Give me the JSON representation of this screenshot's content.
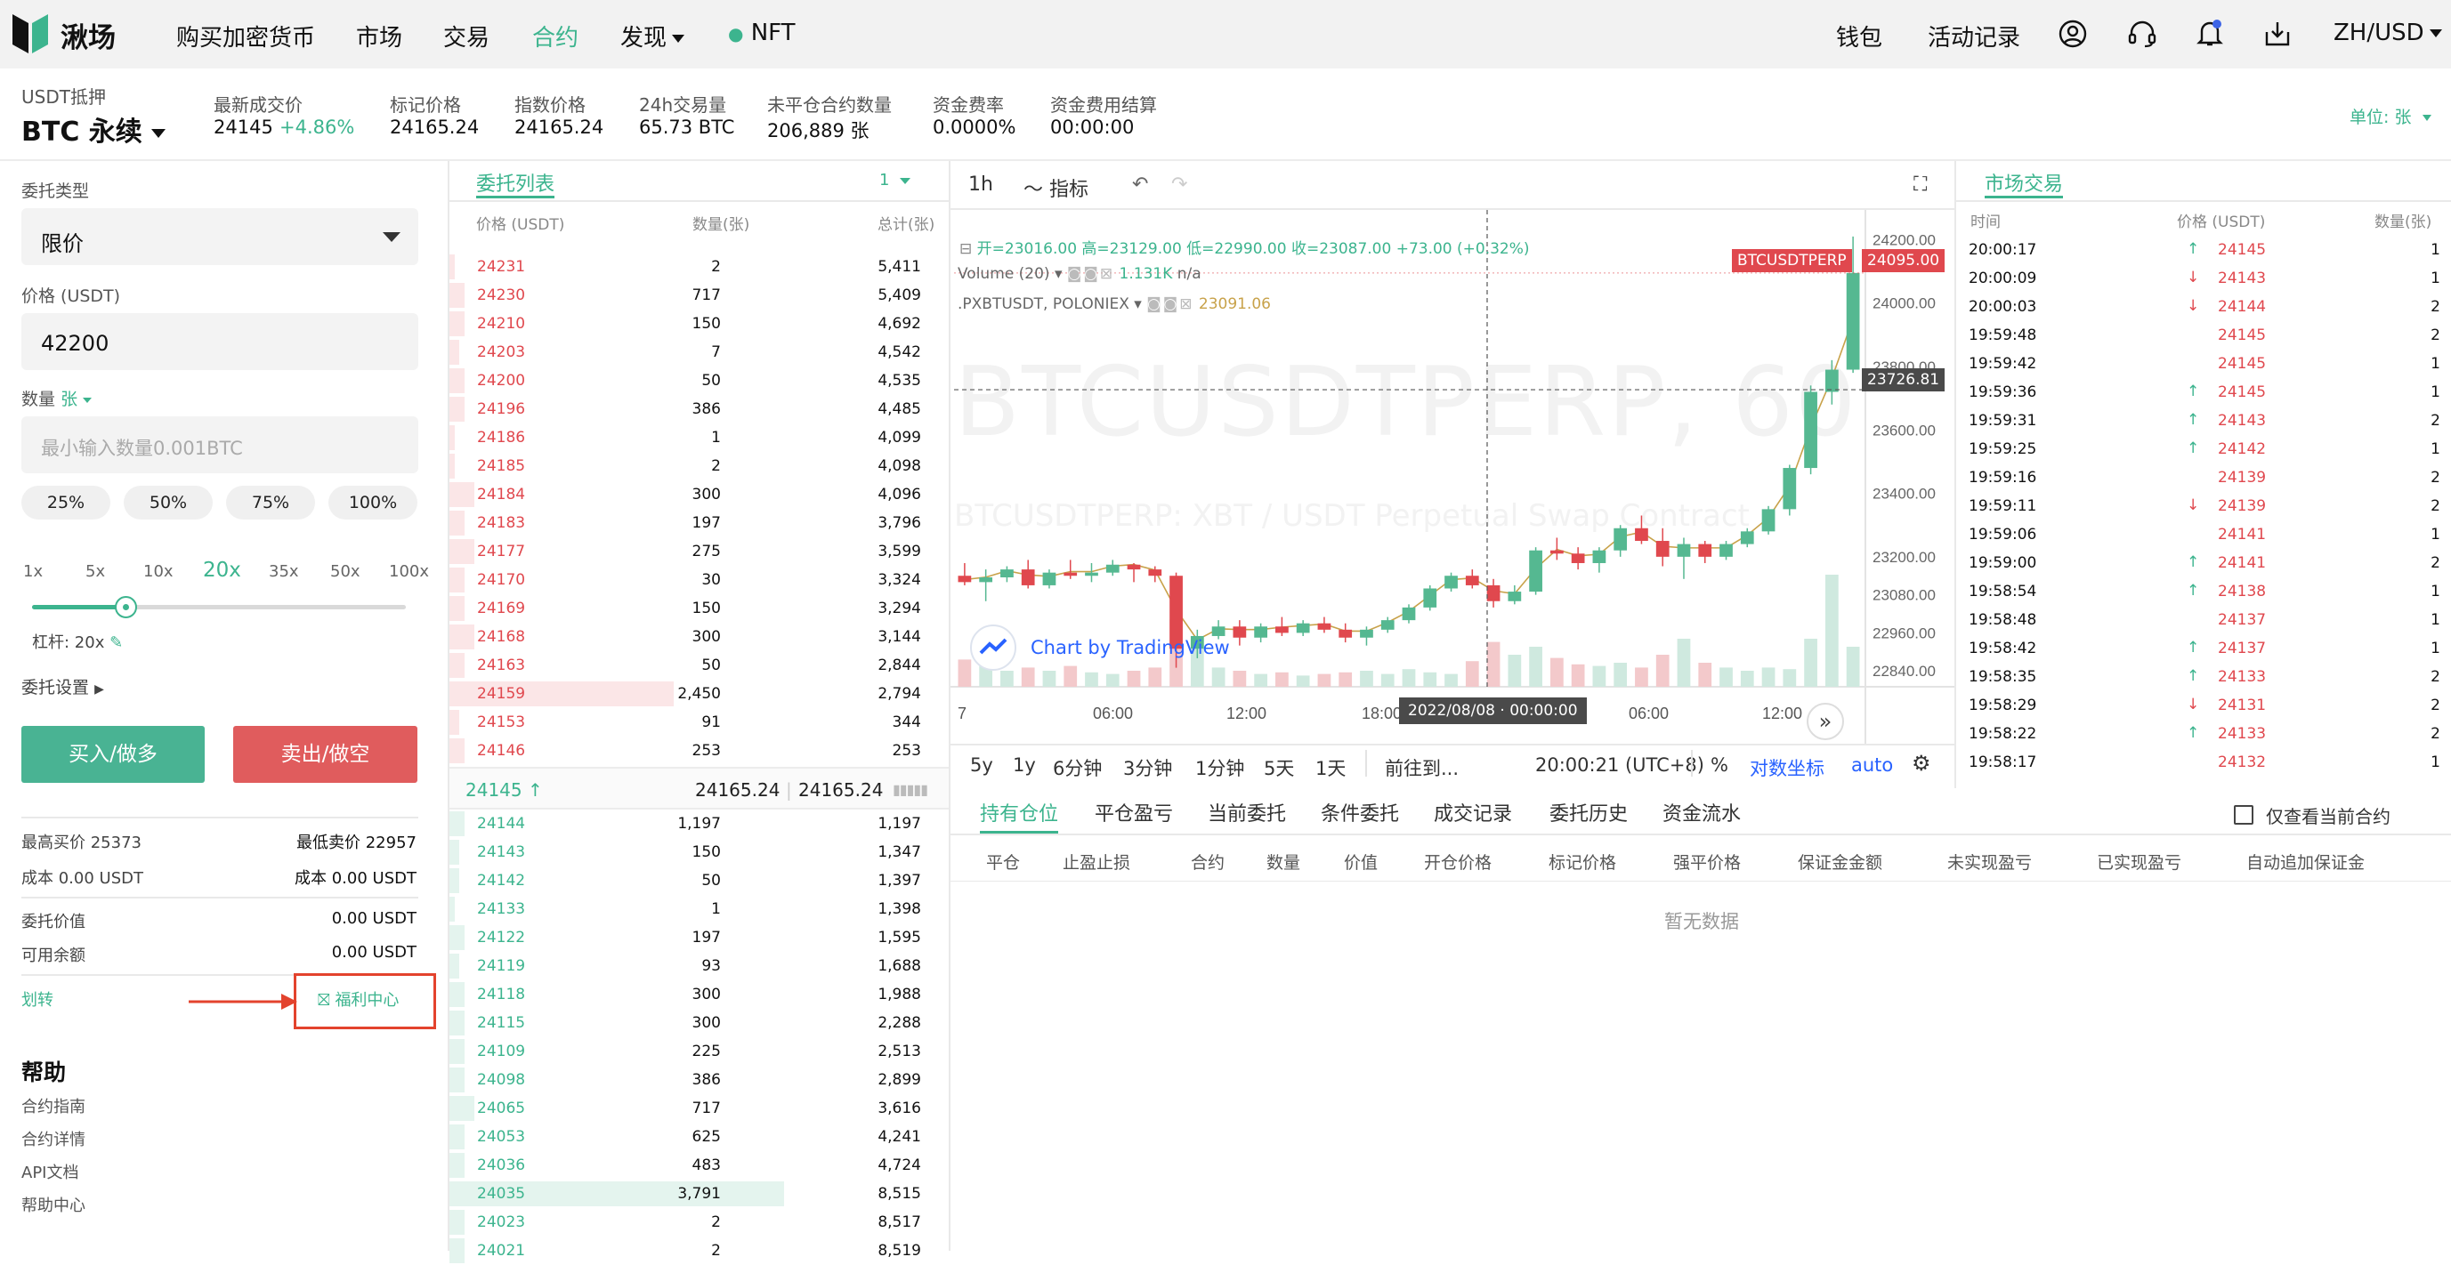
{
  "header": {
    "brand": "湫场",
    "nav": [
      {
        "label": "购买加密货币"
      },
      {
        "label": "市场"
      },
      {
        "label": "交易"
      },
      {
        "label": "合约"
      },
      {
        "label": "发现"
      },
      {
        "label": "NFT"
      }
    ],
    "right": {
      "wallet": "钱包",
      "activity": "活动记录",
      "locale": "ZH/USD"
    }
  },
  "ticker": {
    "collateral": "USDT抵押",
    "symbol": "BTC 永续",
    "stats": [
      {
        "label": "最新成交价",
        "value": "24145",
        "change": "+4.86%"
      },
      {
        "label": "标记价格",
        "value": "24165.24"
      },
      {
        "label": "指数价格",
        "value": "24165.24"
      },
      {
        "label": "24h交易量",
        "value": "65.73 BTC"
      },
      {
        "label": "未平仓合约数量",
        "value": "206,889 张"
      },
      {
        "label": "资金费率",
        "value": "0.0000%"
      },
      {
        "label": "资金费用结算",
        "value": "00:00:00"
      }
    ],
    "unit": "单位: 张"
  },
  "order_form": {
    "type_label": "委托类型",
    "type_value": "限价",
    "price_label": "价格 (USDT)",
    "price_value": "42200",
    "qty_label": "数量",
    "qty_unit": "张",
    "qty_placeholder": "最小输入数量0.001BTC",
    "pct": [
      "25%",
      "50%",
      "75%",
      "100%"
    ],
    "leverages": [
      "1x",
      "5x",
      "10x",
      "20x",
      "35x",
      "50x",
      "100x"
    ],
    "leverage_value": 0.25,
    "leverage_text": "杠杆: 20x",
    "settings": "委托设置",
    "buy": "买入/做多",
    "sell": "卖出/做空",
    "best_bid_label": "最高买价",
    "best_bid": "25373",
    "best_ask_label": "最低卖价",
    "best_ask": "22957",
    "cost_buy": "成本 0.00 USDT",
    "cost_sell_label": "成本",
    "cost_sell": "0.00 USDT",
    "order_value_label": "委托价值",
    "order_value": "0.00 USDT",
    "available_label": "可用余额",
    "available": "0.00 USDT",
    "transfer": "划转",
    "welfare": "福利中心",
    "help_title": "帮助",
    "help_links": [
      "合约指南",
      "合约详情",
      "API文档",
      "帮助中心"
    ]
  },
  "orderbook": {
    "title": "委托列表",
    "precision": "1",
    "headers": [
      "价格 (USDT)",
      "数量(张)",
      "总计(张)"
    ],
    "asks": [
      {
        "price": "24231",
        "qty": "2",
        "total": "5,411",
        "depth": 0.0
      },
      {
        "price": "24230",
        "qty": "717",
        "total": "5,409",
        "depth": 0.03
      },
      {
        "price": "24210",
        "qty": "150",
        "total": "4,692",
        "depth": 0.03
      },
      {
        "price": "24203",
        "qty": "7",
        "total": "4,542",
        "depth": 0.02
      },
      {
        "price": "24200",
        "qty": "50",
        "total": "4,535",
        "depth": 0.03
      },
      {
        "price": "24196",
        "qty": "386",
        "total": "4,485",
        "depth": 0.03
      },
      {
        "price": "24186",
        "qty": "1",
        "total": "4,099",
        "depth": 0.0
      },
      {
        "price": "24185",
        "qty": "2",
        "total": "4,098",
        "depth": 0.0
      },
      {
        "price": "24184",
        "qty": "300",
        "total": "4,096",
        "depth": 0.05
      },
      {
        "price": "24183",
        "qty": "197",
        "total": "3,796",
        "depth": 0.03
      },
      {
        "price": "24177",
        "qty": "275",
        "total": "3,599",
        "depth": 0.05
      },
      {
        "price": "24170",
        "qty": "30",
        "total": "3,324",
        "depth": 0.03
      },
      {
        "price": "24169",
        "qty": "150",
        "total": "3,294",
        "depth": 0.03
      },
      {
        "price": "24168",
        "qty": "300",
        "total": "3,144",
        "depth": 0.05
      },
      {
        "price": "24163",
        "qty": "50",
        "total": "2,844",
        "depth": 0.03
      },
      {
        "price": "24159",
        "qty": "2,450",
        "total": "2,794",
        "depth": 0.45
      },
      {
        "price": "24153",
        "qty": "91",
        "total": "344",
        "depth": 0.02
      },
      {
        "price": "24146",
        "qty": "253",
        "total": "253",
        "depth": 0.03
      }
    ],
    "last_price": "24145",
    "mark_price": "24165.24",
    "index_price": "24165.24",
    "bids": [
      {
        "price": "24144",
        "qty": "1,197",
        "total": "1,197",
        "depth": 0.03
      },
      {
        "price": "24143",
        "qty": "150",
        "total": "1,347",
        "depth": 0.02
      },
      {
        "price": "24142",
        "qty": "50",
        "total": "1,397",
        "depth": 0.02
      },
      {
        "price": "24133",
        "qty": "1",
        "total": "1,398",
        "depth": 0.0
      },
      {
        "price": "24122",
        "qty": "197",
        "total": "1,595",
        "depth": 0.03
      },
      {
        "price": "24119",
        "qty": "93",
        "total": "1,688",
        "depth": 0.02
      },
      {
        "price": "24118",
        "qty": "300",
        "total": "1,988",
        "depth": 0.03
      },
      {
        "price": "24115",
        "qty": "300",
        "total": "2,288",
        "depth": 0.03
      },
      {
        "price": "24109",
        "qty": "225",
        "total": "2,513",
        "depth": 0.03
      },
      {
        "price": "24098",
        "qty": "386",
        "total": "2,899",
        "depth": 0.03
      },
      {
        "price": "24065",
        "qty": "717",
        "total": "3,616",
        "depth": 0.05
      },
      {
        "price": "24053",
        "qty": "625",
        "total": "4,241",
        "depth": 0.03
      },
      {
        "price": "24036",
        "qty": "483",
        "total": "4,724",
        "depth": 0.03
      },
      {
        "price": "24035",
        "qty": "3,791",
        "total": "8,515",
        "depth": 0.67
      },
      {
        "price": "24023",
        "qty": "2",
        "total": "8,517",
        "depth": 0.03
      },
      {
        "price": "24021",
        "qty": "2",
        "total": "8,519",
        "depth": 0.03
      }
    ]
  },
  "chart": {
    "interval": "1h",
    "indicators": "指标",
    "ohlc_line": "开=23016.00 高=23129.00 低=22990.00 收=23087.00 +73.00 (+0.32%)",
    "volume_label": "Volume (20)",
    "volume_value": "1.131K",
    "volume_na": "n/a",
    "compare_label": ".PXBTUSDT, POLONIEX",
    "compare_value": "23091.06",
    "watermark_big": "BTCUSDTPERP, 60",
    "watermark_small": "BTCUSDTPERP: XBT / USDT Perpetual Swap Contract",
    "attribution": "Chart by TradingView",
    "symbol_tag": "BTCUSDTPERP",
    "last_tag": "24095.00",
    "cross_tag": "23726.81",
    "time_tag": "2022/08/08 · 00:00:00",
    "y_ticks": [
      "24200.00",
      "24000.00",
      "23800.00",
      "23600.00",
      "23400.00",
      "23200.00",
      "23080.00",
      "22960.00",
      "22840.00"
    ],
    "x_ticks": [
      "7",
      "06:00",
      "12:00",
      "18:00",
      "06:00",
      "12:00"
    ],
    "ranges": [
      "5y",
      "1y",
      "6分钟",
      "3分钟",
      "1分钟",
      "5天",
      "1天",
      "前往到..."
    ],
    "clock": "20:00:21 (UTC+8)",
    "pct": "%",
    "log": "对数坐标",
    "auto": "auto"
  },
  "chart_data": {
    "type": "candlestick",
    "y_range": [
      22790,
      24260
    ],
    "candles": [
      [
        23140,
        23180,
        23110,
        23120
      ],
      [
        23120,
        23160,
        23060,
        23135
      ],
      [
        23135,
        23170,
        23120,
        23160
      ],
      [
        23160,
        23190,
        23100,
        23110
      ],
      [
        23110,
        23160,
        23100,
        23150
      ],
      [
        23150,
        23190,
        23130,
        23140
      ],
      [
        23140,
        23180,
        23120,
        23150
      ],
      [
        23150,
        23190,
        23140,
        23175
      ],
      [
        23175,
        23180,
        23120,
        23160
      ],
      [
        23160,
        23170,
        23120,
        23140
      ],
      [
        23140,
        23150,
        22850,
        22910
      ],
      [
        22910,
        22970,
        22880,
        22950
      ],
      [
        22950,
        23000,
        22940,
        22980
      ],
      [
        22980,
        23000,
        22920,
        22945
      ],
      [
        22945,
        22990,
        22930,
        22980
      ],
      [
        22980,
        23010,
        22950,
        22960
      ],
      [
        22960,
        23000,
        22950,
        22990
      ],
      [
        22990,
        23010,
        22960,
        22970
      ],
      [
        22970,
        22990,
        22930,
        22945
      ],
      [
        22945,
        22980,
        22920,
        22970
      ],
      [
        22970,
        23010,
        22960,
        23000
      ],
      [
        23000,
        23050,
        22990,
        23040
      ],
      [
        23040,
        23110,
        23030,
        23100
      ],
      [
        23100,
        23150,
        23090,
        23140
      ],
      [
        23140,
        23160,
        23100,
        23110
      ],
      [
        23110,
        23130,
        23040,
        23060
      ],
      [
        23060,
        23110,
        23050,
        23090
      ],
      [
        23090,
        23230,
        23080,
        23220
      ],
      [
        23220,
        23260,
        23190,
        23210
      ],
      [
        23210,
        23230,
        23160,
        23180
      ],
      [
        23180,
        23230,
        23150,
        23220
      ],
      [
        23220,
        23300,
        23200,
        23290
      ],
      [
        23290,
        23330,
        23240,
        23250
      ],
      [
        23250,
        23290,
        23170,
        23200
      ],
      [
        23200,
        23260,
        23130,
        23240
      ],
      [
        23240,
        23250,
        23180,
        23200
      ],
      [
        23200,
        23250,
        23190,
        23240
      ],
      [
        23240,
        23290,
        23230,
        23280
      ],
      [
        23280,
        23360,
        23270,
        23350
      ],
      [
        23350,
        23490,
        23330,
        23480
      ],
      [
        23480,
        23740,
        23460,
        23720
      ],
      [
        23720,
        23820,
        23680,
        23790
      ],
      [
        23790,
        24210,
        23780,
        24095
      ]
    ],
    "volumes": [
      0.17,
      0.15,
      0.1,
      0.12,
      0.1,
      0.13,
      0.09,
      0.08,
      0.1,
      0.12,
      0.42,
      0.3,
      0.12,
      0.1,
      0.08,
      0.09,
      0.07,
      0.08,
      0.09,
      0.1,
      0.08,
      0.11,
      0.09,
      0.08,
      0.16,
      0.28,
      0.2,
      0.25,
      0.18,
      0.14,
      0.13,
      0.15,
      0.12,
      0.2,
      0.3,
      0.15,
      0.12,
      0.1,
      0.12,
      0.11,
      0.3,
      0.7,
      0.25
    ]
  },
  "bottom": {
    "tabs": [
      "持有仓位",
      "平仓盈亏",
      "当前委托",
      "条件委托",
      "成交记录",
      "委托历史",
      "资金流水"
    ],
    "only_current": "仅查看当前合约",
    "columns": [
      "平仓",
      "止盈止损",
      "合约",
      "数量",
      "价值",
      "开仓价格",
      "标记价格",
      "强平价格",
      "保证金金额",
      "未实现盈亏",
      "已实现盈亏",
      "自动追加保证金"
    ],
    "empty": "暂无数据"
  },
  "trades": {
    "title": "市场交易",
    "headers": [
      "时间",
      "价格 (USDT)",
      "数量(张)"
    ],
    "rows": [
      {
        "time": "20:00:17",
        "dir": "up",
        "price": "24145",
        "amount": "1"
      },
      {
        "time": "20:00:09",
        "dir": "down",
        "price": "24143",
        "amount": "1"
      },
      {
        "time": "20:00:03",
        "dir": "down",
        "price": "24144",
        "amount": "2"
      },
      {
        "time": "19:59:48",
        "dir": "",
        "price": "24145",
        "amount": "2"
      },
      {
        "time": "19:59:42",
        "dir": "",
        "price": "24145",
        "amount": "1"
      },
      {
        "time": "19:59:36",
        "dir": "up",
        "price": "24145",
        "amount": "1"
      },
      {
        "time": "19:59:31",
        "dir": "up",
        "price": "24143",
        "amount": "2"
      },
      {
        "time": "19:59:25",
        "dir": "up",
        "price": "24142",
        "amount": "1"
      },
      {
        "time": "19:59:16",
        "dir": "",
        "price": "24139",
        "amount": "2"
      },
      {
        "time": "19:59:11",
        "dir": "down",
        "price": "24139",
        "amount": "2"
      },
      {
        "time": "19:59:06",
        "dir": "",
        "price": "24141",
        "amount": "1"
      },
      {
        "time": "19:59:00",
        "dir": "up",
        "price": "24141",
        "amount": "2"
      },
      {
        "time": "19:58:54",
        "dir": "up",
        "price": "24138",
        "amount": "1"
      },
      {
        "time": "19:58:48",
        "dir": "",
        "price": "24137",
        "amount": "1"
      },
      {
        "time": "19:58:42",
        "dir": "up",
        "price": "24137",
        "amount": "1"
      },
      {
        "time": "19:58:35",
        "dir": "up",
        "price": "24133",
        "amount": "2"
      },
      {
        "time": "19:58:29",
        "dir": "down",
        "price": "24131",
        "amount": "2"
      },
      {
        "time": "19:58:22",
        "dir": "up",
        "price": "24133",
        "amount": "2"
      },
      {
        "time": "19:58:17",
        "dir": "",
        "price": "24132",
        "amount": "1"
      }
    ]
  }
}
